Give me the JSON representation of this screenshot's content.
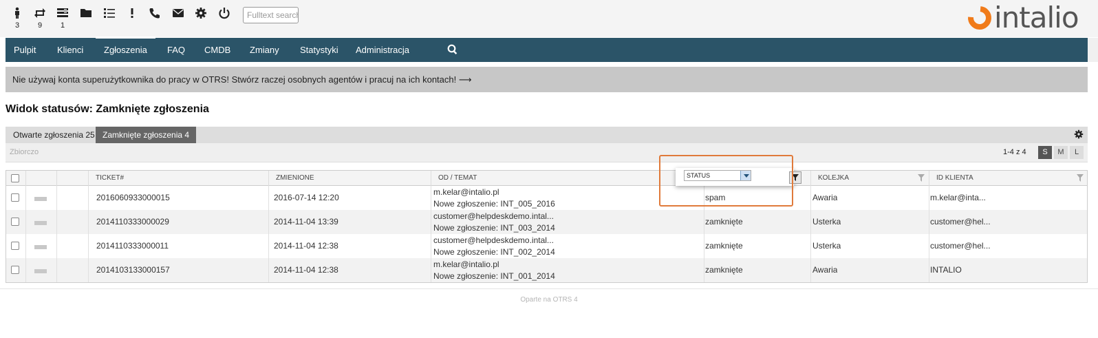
{
  "toolbar": {
    "icons": [
      {
        "name": "person-icon",
        "count": "3"
      },
      {
        "name": "refresh-icon",
        "count": "9"
      },
      {
        "name": "list-icon",
        "count": "1"
      },
      {
        "name": "folder-icon",
        "count": ""
      },
      {
        "name": "ordered-list-icon",
        "count": ""
      },
      {
        "name": "exclamation-icon",
        "count": ""
      },
      {
        "name": "phone-icon",
        "count": ""
      },
      {
        "name": "mail-icon",
        "count": ""
      },
      {
        "name": "gear-icon",
        "count": ""
      },
      {
        "name": "power-icon",
        "count": ""
      }
    ],
    "search_placeholder": "Fulltext search"
  },
  "logo": {
    "text": "intalio"
  },
  "nav": {
    "items": [
      "Pulpit",
      "Klienci",
      "Zgłoszenia",
      "FAQ",
      "CMDB",
      "Zmiany",
      "Statystyki",
      "Administracja"
    ],
    "active": "Zgłoszenia"
  },
  "notice": {
    "text": "Nie używaj konta superużytkownika do pracy w OTRS! Stwórz raczej osobnych agentów i pracuj na ich kontach! ⟶"
  },
  "page": {
    "title": "Widok statusów: Zamknięte zgłoszenia"
  },
  "tabs": {
    "open": "Otwarte zgłoszenia 25",
    "closed": "Zamknięte zgłoszenia 4"
  },
  "view": {
    "mode": "Zbiorczo",
    "pagination": "1-4 z 4",
    "sizes": [
      "S",
      "M",
      "L"
    ]
  },
  "table": {
    "headers": {
      "ticket": "TICKET#",
      "changed": "ZMIENIONE",
      "from_subject": "OD / TEMAT",
      "status": "STATUS",
      "queue": "KOLEJKA",
      "customer_id": "ID KLIENTA"
    },
    "rows": [
      {
        "ticket": "2016060933000015",
        "changed": "2016-07-14 12:20",
        "from": "m.kelar@intalio.pl",
        "subject": "Nowe zgłoszenie: INT_005_2016",
        "status": "spam",
        "queue": "Awaria",
        "customer": "m.kelar@inta..."
      },
      {
        "ticket": "2014110333000029",
        "changed": "2014-11-04 13:39",
        "from": "customer@helpdeskdemo.intal...",
        "subject": "Nowe zgłoszenie: INT_003_2014",
        "status": "zamknięte",
        "queue": "Usterka",
        "customer": "customer@hel..."
      },
      {
        "ticket": "2014110333000011",
        "changed": "2014-11-04 12:38",
        "from": "customer@helpdeskdemo.intal...",
        "subject": "Nowe zgłoszenie: INT_002_2014",
        "status": "zamknięte",
        "queue": "Usterka",
        "customer": "customer@hel..."
      },
      {
        "ticket": "2014103133000157",
        "changed": "2014-11-04 12:38",
        "from": "m.kelar@intalio.pl",
        "subject": "Nowe zgłoszenie: INT_001_2014",
        "status": "zamknięte",
        "queue": "Awaria",
        "customer": "INTALIO"
      }
    ]
  },
  "status_filter": {
    "selected": "STATUS"
  },
  "footer": {
    "text": "Oparte na OTRS 4"
  },
  "colors": {
    "nav": "#2b5468",
    "accent": "#f07b1a",
    "highlight": "#e07a3a"
  }
}
